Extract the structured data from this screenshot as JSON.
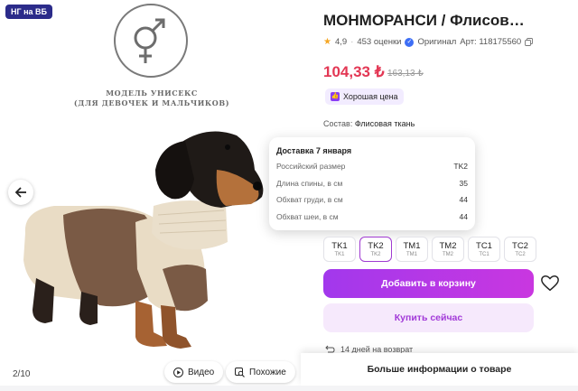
{
  "gallery": {
    "badge": "НГ на ВБ",
    "model_text_line1": "МОДЕЛЬ УНИСЕКС",
    "model_text_line2": "(ДЛЯ ДЕВОЧЕК И МАЛЬЧИКОВ)",
    "counter": "2/10",
    "video_label": "Видео",
    "similar_label": "Похожие"
  },
  "product": {
    "title": "МОНМОРАНСИ / Флисовый комб…",
    "rating": "4,9",
    "reviews": "453 оценки",
    "original_label": "Оригинал",
    "article": "Арт: 118175560",
    "price": "104,33 ₺",
    "old_price": "163,13 ₺",
    "good_price_label": "Хорошая цена",
    "composition_label": "Состав:",
    "composition_value": "Флисовая ткань",
    "add_to_cart": "Добавить в корзину",
    "buy_now": "Купить сейчас",
    "returns": "14 дней на возврат",
    "more_info": "Больше информации о товаре"
  },
  "popup": {
    "title": "Доставка 7 января",
    "rows": [
      {
        "label": "Российский размер",
        "value": "TK2"
      },
      {
        "label": "Длина спины, в см",
        "value": "35"
      },
      {
        "label": "Обхват груди, в см",
        "value": "44"
      },
      {
        "label": "Обхват шеи, в см",
        "value": "44"
      }
    ]
  },
  "sizes": [
    {
      "main": "TK1",
      "sub": "TK1"
    },
    {
      "main": "TK2",
      "sub": "TK2"
    },
    {
      "main": "TM1",
      "sub": "TM1"
    },
    {
      "main": "TM2",
      "sub": "TM2"
    },
    {
      "main": "TC1",
      "sub": "TC1"
    },
    {
      "main": "TC2",
      "sub": "TC2"
    }
  ],
  "selected_size": "TK2",
  "colors": {
    "accent": "#a238ec",
    "price": "#e33754",
    "good_price_bg": "#f2ecff"
  }
}
